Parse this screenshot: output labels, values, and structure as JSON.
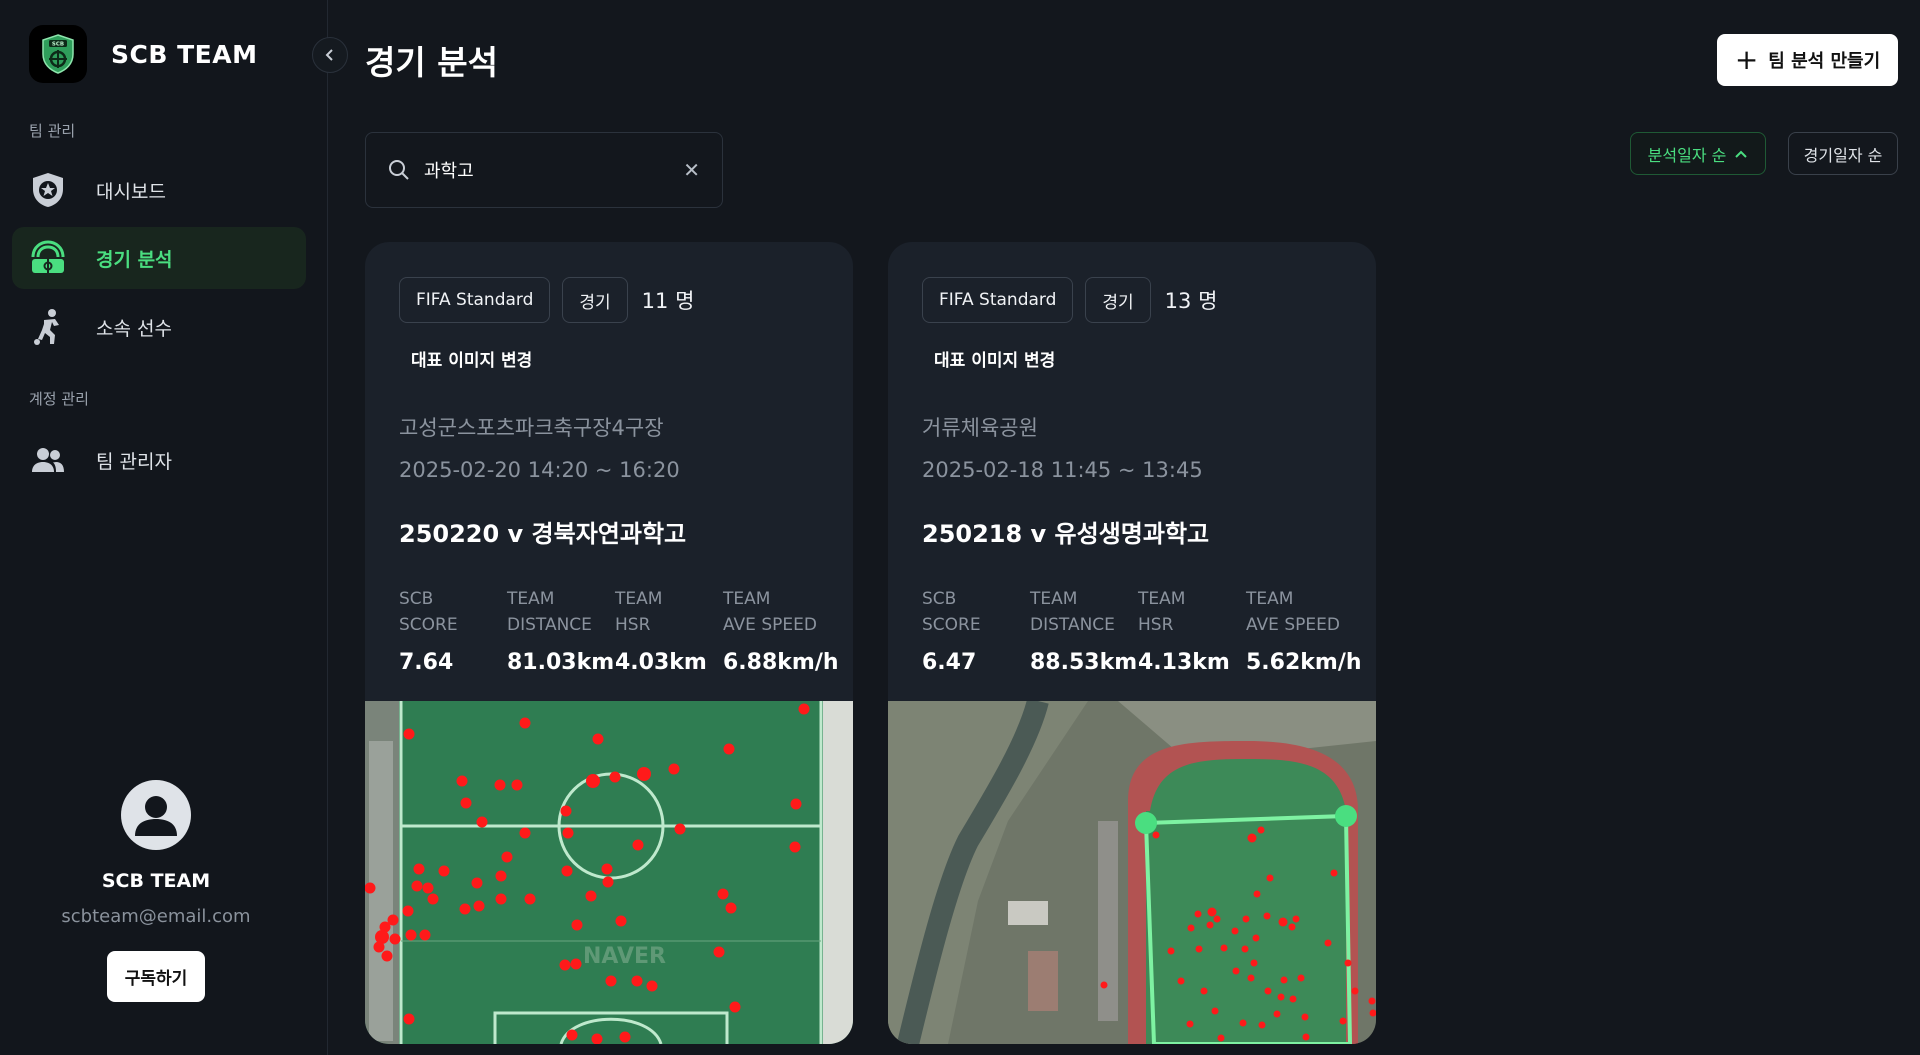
{
  "brand": {
    "name": "SCB TEAM",
    "logo_icon": "scb-shield-logo"
  },
  "sidebar": {
    "sections": [
      {
        "label": "팀 관리"
      },
      {
        "label": "계정 관리"
      }
    ],
    "items": [
      {
        "label": "대시보드",
        "icon": "shield-star-icon",
        "active": false
      },
      {
        "label": "경기 분석",
        "icon": "field-analysis-icon",
        "active": true
      },
      {
        "label": "소속 선수",
        "icon": "player-kick-icon",
        "active": false
      },
      {
        "label": "팀 관리자",
        "icon": "people-icon",
        "active": false
      }
    ]
  },
  "profile": {
    "name": "SCB TEAM",
    "email": "scbteam@email.com",
    "subscribe_label": "구독하기"
  },
  "header": {
    "title": "경기 분석",
    "create_label": "팀 분석 만들기"
  },
  "search": {
    "value": "과학고"
  },
  "sort": {
    "active_label": "분석일자 순",
    "inactive_label": "경기일자 순"
  },
  "colors": {
    "accent": "#4ade80",
    "background": "#13171d",
    "card": "#1b212a",
    "dot": "#ff1a1a"
  },
  "cards": [
    {
      "tag_format": "FIFA Standard",
      "tag_type": "경기",
      "players": "11 명",
      "change_image_label": "대표 이미지 변경",
      "venue": "고성군스포츠파크축구장4구장",
      "datetime": "2025-02-20 14:20 ~ 16:20",
      "title": "250220 v 경북자연과학고",
      "stats": [
        {
          "label": "SCB\nSCORE",
          "value": "7.64"
        },
        {
          "label": "TEAM\nDISTANCE",
          "value": "81.03km"
        },
        {
          "label": "TEAM\nHSR",
          "value": "4.03km"
        },
        {
          "label": "TEAM\nAVE SPEED",
          "value": "6.88km/h"
        }
      ],
      "map_watermark": "NAVER"
    },
    {
      "tag_format": "FIFA Standard",
      "tag_type": "경기",
      "players": "13 명",
      "change_image_label": "대표 이미지 변경",
      "venue": "거류체육공원",
      "datetime": "2025-02-18 11:45 ~ 13:45",
      "title": "250218 v 유성생명과학고",
      "stats": [
        {
          "label": "SCB\nSCORE",
          "value": "6.47"
        },
        {
          "label": "TEAM\nDISTANCE",
          "value": "88.53km"
        },
        {
          "label": "TEAM\nHSR",
          "value": "4.13km"
        },
        {
          "label": "TEAM\nAVE SPEED",
          "value": "5.62km/h"
        }
      ]
    }
  ]
}
